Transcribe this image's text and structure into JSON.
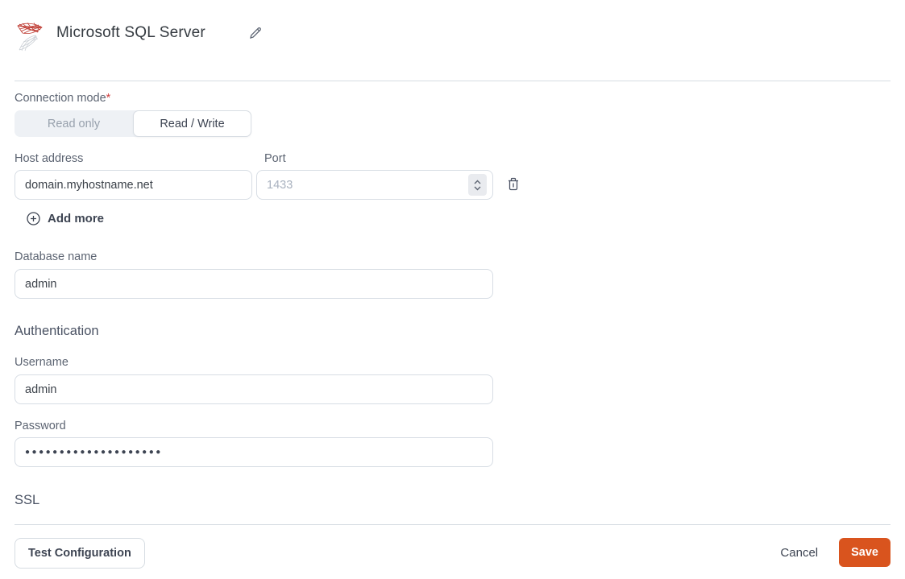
{
  "header": {
    "title": "Microsoft SQL Server",
    "logo_icon": "sql-server-logo",
    "edit_icon": "pencil-icon"
  },
  "form": {
    "connection_mode": {
      "label": "Connection mode",
      "required_marker": "*",
      "options": [
        {
          "label": "Read only",
          "selected": false
        },
        {
          "label": "Read / Write",
          "selected": true
        }
      ]
    },
    "host": {
      "label": "Host address",
      "value": "domain.myhostname.net"
    },
    "port": {
      "label": "Port",
      "placeholder": "1433",
      "stepper_icon": "number-stepper",
      "remove_icon": "trash-icon"
    },
    "add_more": {
      "label": "Add more",
      "icon": "plus-circle-icon"
    },
    "database": {
      "label": "Database name",
      "value": "admin"
    },
    "authentication": {
      "heading": "Authentication",
      "username": {
        "label": "Username",
        "value": "admin"
      },
      "password": {
        "label": "Password",
        "masked_value": "●●●●●●●●●●●●●●●●●●●●"
      }
    },
    "ssl": {
      "heading": "SSL"
    }
  },
  "footer": {
    "test_button_label": "Test Configuration",
    "cancel_label": "Cancel",
    "save_label": "Save"
  },
  "colors": {
    "accent_save": "#D9541E",
    "required_asterisk": "#CF3F3F",
    "logo_red": "#BE3A31",
    "logo_gray": "#C9CED4",
    "divider": "#D6DCE2",
    "toggle_bg": "#EEF1F5",
    "label_text": "#5C6472",
    "input_border": "#D7DDE4"
  }
}
